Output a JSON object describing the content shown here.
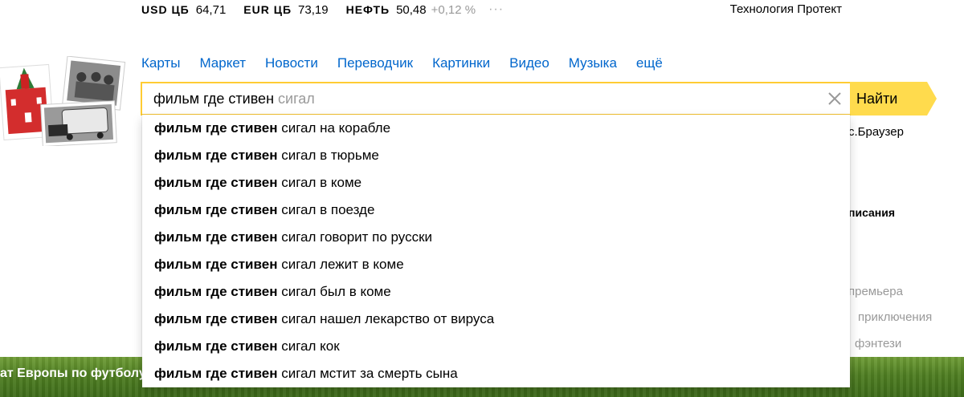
{
  "ticker": [
    {
      "label": "USD ЦБ",
      "value": "64,71",
      "change": ""
    },
    {
      "label": "EUR ЦБ",
      "value": "73,19",
      "change": ""
    },
    {
      "label": "НЕФТЬ",
      "value": "50,48",
      "change": "+0,12 %"
    }
  ],
  "ticker_more": "···",
  "promo_link": "Технология Протект",
  "nav": [
    "Карты",
    "Маркет",
    "Новости",
    "Переводчик",
    "Картинки",
    "Видео",
    "Музыка",
    "ещё"
  ],
  "search": {
    "typed": "фильм где стивен ",
    "hint": "сигал",
    "button": "Найти"
  },
  "suggestions": [
    {
      "bold": "фильм где стивен",
      "rest": " сигал на корабле"
    },
    {
      "bold": "фильм где стивен",
      "rest": " сигал в тюрьме"
    },
    {
      "bold": "фильм где стивен",
      "rest": " сигал в коме"
    },
    {
      "bold": "фильм где стивен",
      "rest": " сигал в поезде"
    },
    {
      "bold": "фильм где стивен",
      "rest": " сигал говорит по русски"
    },
    {
      "bold": "фильм где стивен",
      "rest": " сигал лежит в коме"
    },
    {
      "bold": "фильм где стивен",
      "rest": " сигал был в коме"
    },
    {
      "bold": "фильм где стивен",
      "rest": " сигал нашел лекарство от вируса"
    },
    {
      "bold": "фильм где стивен",
      "rest": " сигал кок"
    },
    {
      "bold": "фильм где стивен",
      "rest": " сигал мстит за смерть сына"
    }
  ],
  "side": {
    "browser": "с.Браузер",
    "heading": "писания",
    "tags": [
      "премьера",
      "приключения",
      "фэнтези"
    ]
  },
  "news_strip": "ат Европы по футболу",
  "colors": {
    "link": "#0066cc",
    "search_border": "#ffcc33",
    "button": "#ffdb4d"
  }
}
